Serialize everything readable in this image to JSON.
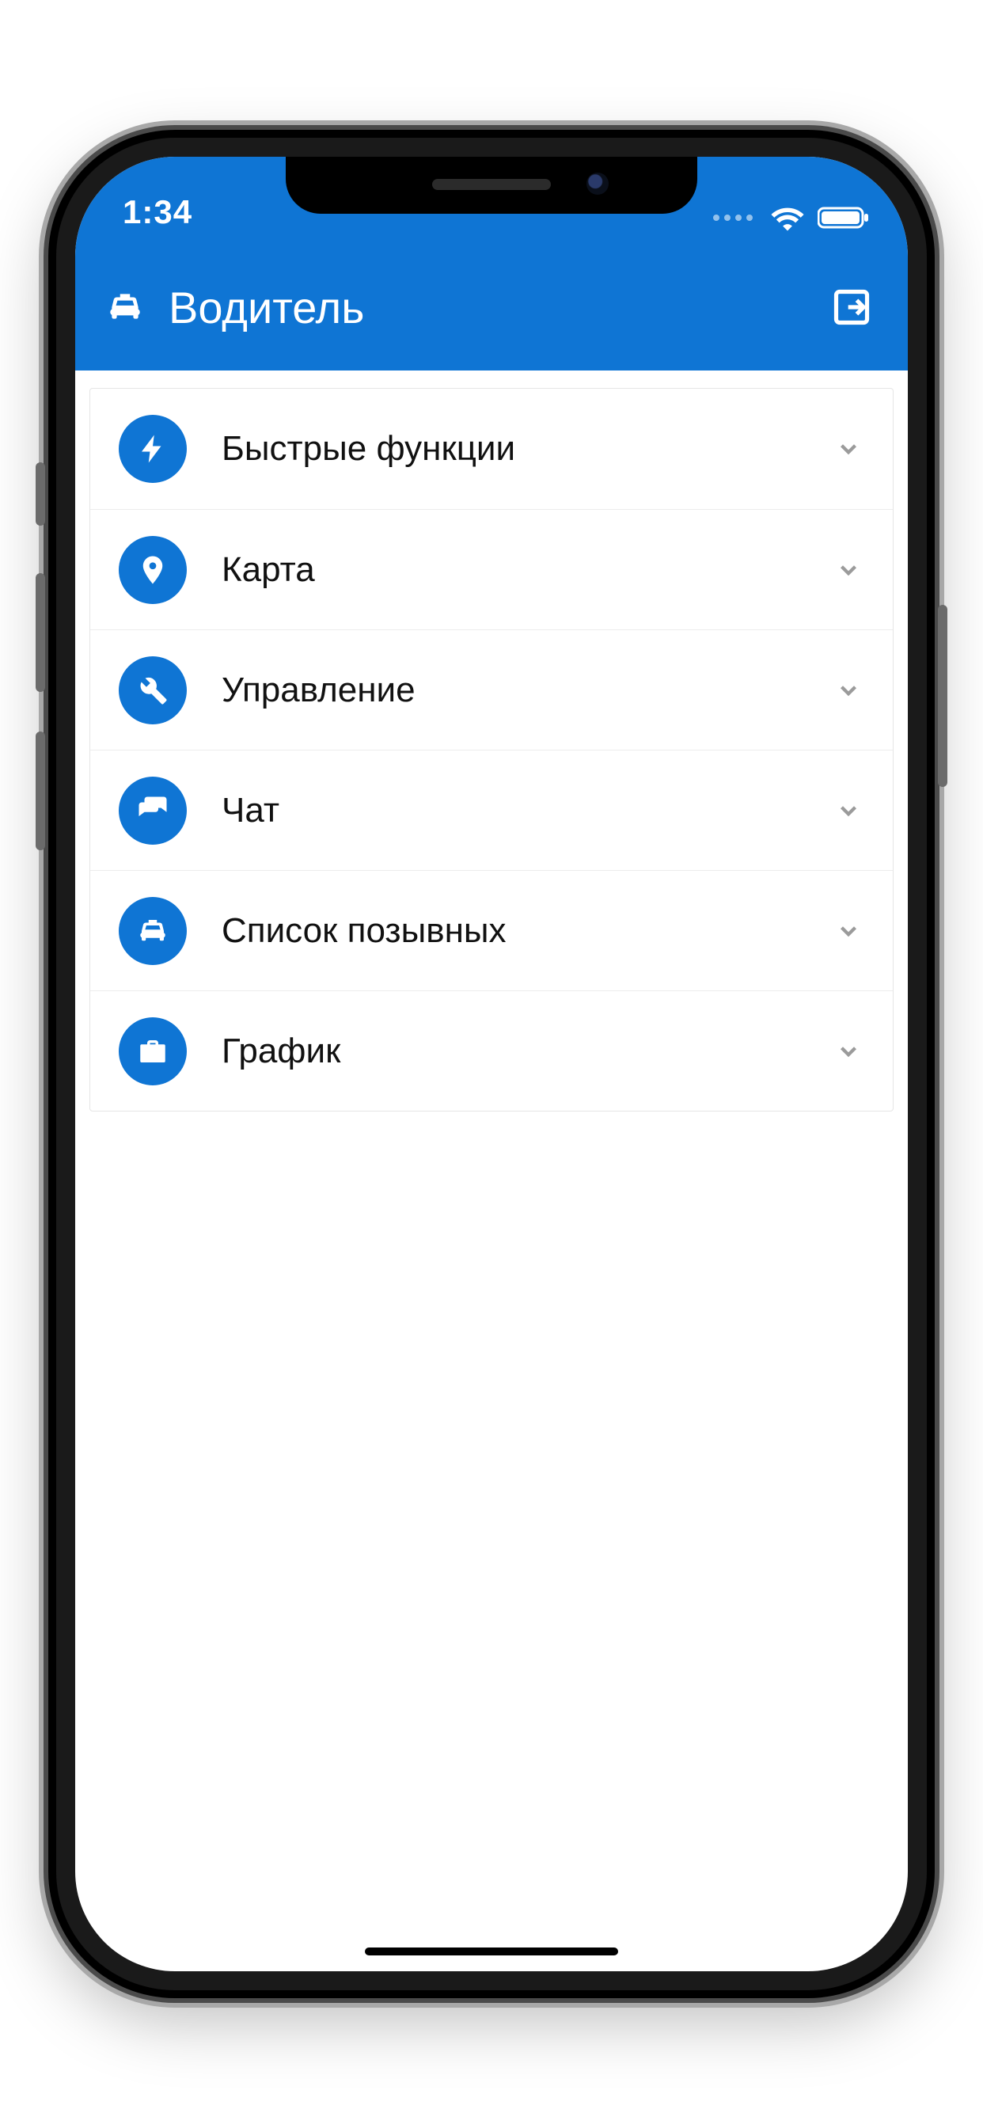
{
  "status": {
    "time": "1:34"
  },
  "header": {
    "title": "Водитель",
    "left_icon": "taxi-icon",
    "right_icon": "logout-icon"
  },
  "menu": {
    "items": [
      {
        "icon": "bolt-icon",
        "label": "Быстрые функции"
      },
      {
        "icon": "pin-icon",
        "label": "Карта"
      },
      {
        "icon": "wrench-icon",
        "label": "Управление"
      },
      {
        "icon": "chat-icon",
        "label": "Чат"
      },
      {
        "icon": "taxi-icon",
        "label": "Список позывных"
      },
      {
        "icon": "briefcase-icon",
        "label": "График"
      }
    ]
  },
  "colors": {
    "accent": "#0f75d4"
  }
}
